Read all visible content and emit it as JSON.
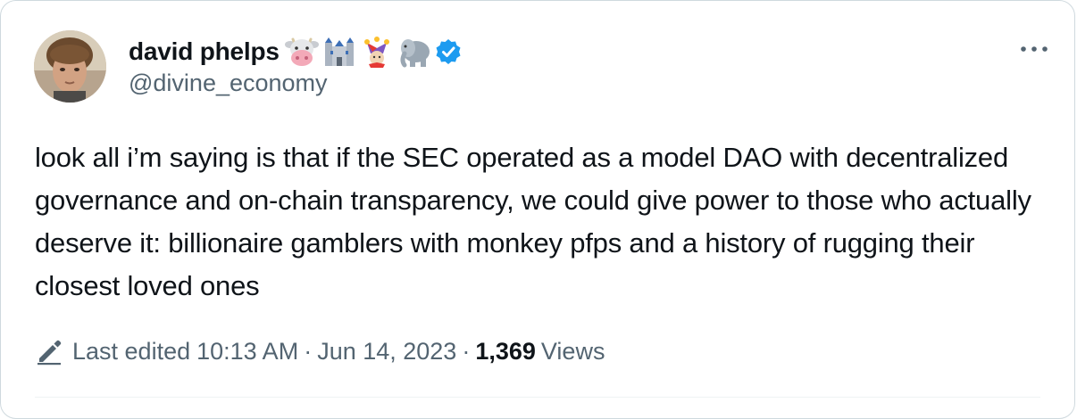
{
  "author": {
    "display_name": "david phelps",
    "handle": "@divine_economy",
    "name_emojis": [
      "cow-face",
      "castle",
      "jester",
      "elephant"
    ],
    "verified": true
  },
  "tweet": {
    "text": "look all i’m saying is that if the SEC operated as a model DAO with decentralized governance and on-chain transparency, we could give power to those who actually deserve it: billionaire gamblers with monkey pfps and a history of rugging their closest loved ones"
  },
  "meta": {
    "edited_prefix": "Last edited",
    "time": "10:13 AM",
    "separator": "·",
    "date": "Jun 14, 2023",
    "views_count": "1,369",
    "views_label": "Views"
  },
  "colors": {
    "text_primary": "#0f1419",
    "text_secondary": "#536471",
    "verified_blue": "#1d9bf0",
    "border": "#cfd9de"
  }
}
